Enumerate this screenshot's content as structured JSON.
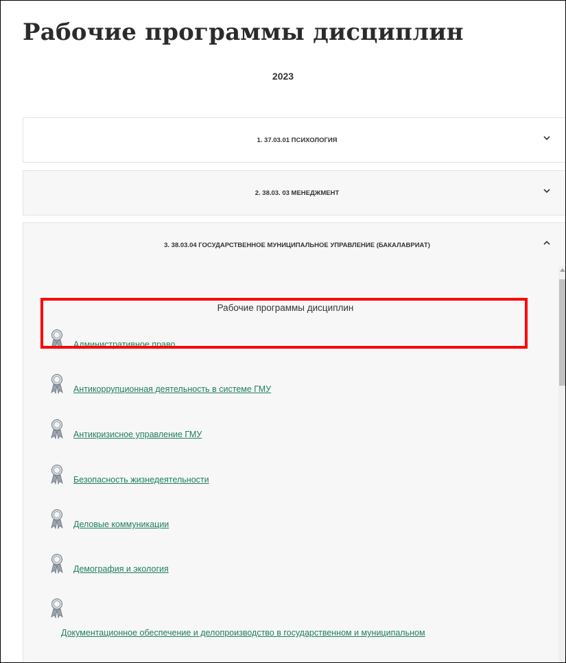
{
  "page": {
    "title": "Рабочие программы дисциплин",
    "year": "2023"
  },
  "accordion": [
    {
      "label": "1. 37.03.01 ПСИХОЛОГИЯ",
      "expanded": false
    },
    {
      "label": "2. 38.03. 03 МЕНЕДЖМЕНТ",
      "expanded": false
    },
    {
      "label": "3. 38.03.04 ГОСУДАРСТВЕННОЕ МУНИЦИПАЛЬНОЕ УПРАВЛЕНИЕ (БАКАЛАВРИАТ)",
      "expanded": true
    }
  ],
  "section": {
    "title": "Рабочие программы дисциплин",
    "documents": [
      "Административное право",
      "Антикоррупционная деятельность в системе ГМУ",
      "Антикризисное управление ГМУ",
      "Безопасность жизнедеятельности",
      "Деловые коммуникации",
      "Демография и экология",
      "Документационное обеспечение и делопроизводство в государственном и муниципальном"
    ]
  },
  "colors": {
    "link": "#1e7f5c",
    "highlight": "#ff0000",
    "panel": "#f7f7f7"
  },
  "icons": {
    "chevron_collapsed": "chevron-down-icon",
    "chevron_expanded": "chevron-up-icon",
    "document": "award-ribbon-icon"
  }
}
